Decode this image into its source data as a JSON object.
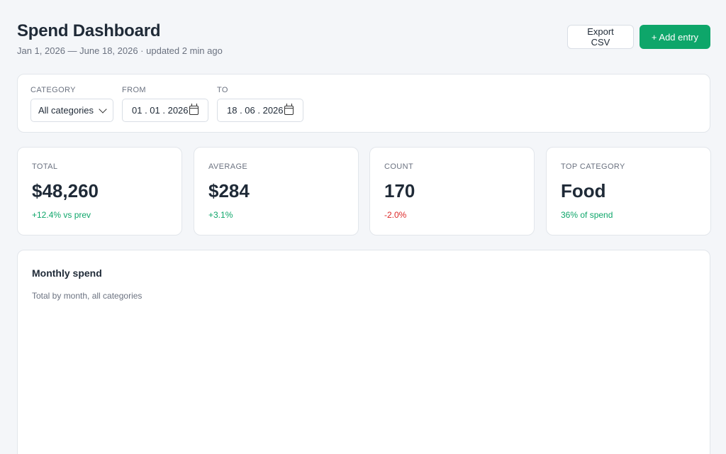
{
  "header": {
    "title": "Spend Dashboard",
    "subtitle": "Jan 1, 2026 — June 18, 2026 · updated 2 min ago",
    "export_label": "Export CSV",
    "add_label": "+ Add entry"
  },
  "filters": {
    "category_label": "CATEGORY",
    "category_value": "All categories",
    "from_label": "FROM",
    "from_value": "01 . 01 . 2026",
    "to_label": "TO",
    "to_value": "18 . 06 . 2026"
  },
  "stats": [
    {
      "label": "TOTAL",
      "value": "$48,260",
      "delta": "+12.4% vs prev",
      "trend": "positive"
    },
    {
      "label": "AVERAGE",
      "value": "$284",
      "delta": "+3.1%",
      "trend": "positive"
    },
    {
      "label": "COUNT",
      "value": "170",
      "delta": "-2.0%",
      "trend": "negative"
    },
    {
      "label": "TOP CATEGORY",
      "value": "Food",
      "delta": "36% of spend",
      "trend": "positive"
    }
  ],
  "chart": {
    "title": "Monthly spend",
    "subtitle": "Total by month, all categories"
  },
  "colors": {
    "accent": "#0ea66a",
    "negative": "#dc2626"
  }
}
